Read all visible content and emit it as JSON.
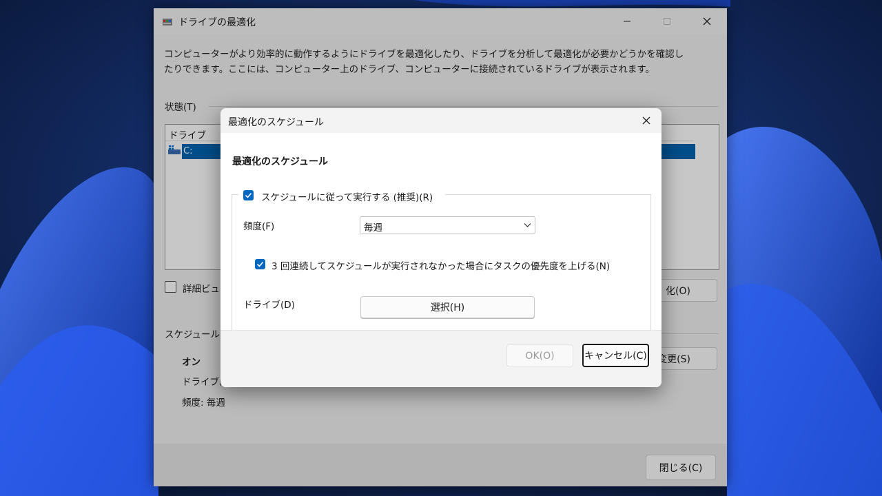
{
  "main_window": {
    "title": "ドライブの最適化",
    "description": "コンピューターがより効率的に動作するようにドライブを最適化したり、ドライブを分析して最適化が必要かどうかを確認したりできます。ここには、コンピューター上のドライブ、コンピューターに接続されているドライブが表示されます。",
    "status_label": "状態(T)",
    "drive_column_header": "ドライブ",
    "drive_row": "C:",
    "detail_view_label": "詳細ビュー",
    "optimize_button": "化(O)",
    "schedule_label": "スケジュールさ",
    "schedule_on": "オン",
    "schedule_drives": "ドライブは",
    "schedule_frequency": "頻度: 毎週",
    "change_settings_button": "変更(S)",
    "close_button": "閉じる(C)"
  },
  "dialog": {
    "title": "最適化のスケジュール",
    "heading": "最適化のスケジュール",
    "run_on_schedule": {
      "label": "スケジュールに従って実行する (推奨)(R)",
      "checked": true
    },
    "frequency_label": "頻度(F)",
    "frequency_value": "毎週",
    "priority_option": {
      "label": "3 回連続してスケジュールが実行されなかった場合にタスクの優先度を上げる(N)",
      "checked": true
    },
    "drives_label": "ドライブ(D)",
    "select_button": "選択(H)",
    "ok_button": "OK(O)",
    "cancel_button": "キャンセル(C)"
  },
  "colors": {
    "accent": "#0067c0",
    "selection": "#0063b1"
  }
}
